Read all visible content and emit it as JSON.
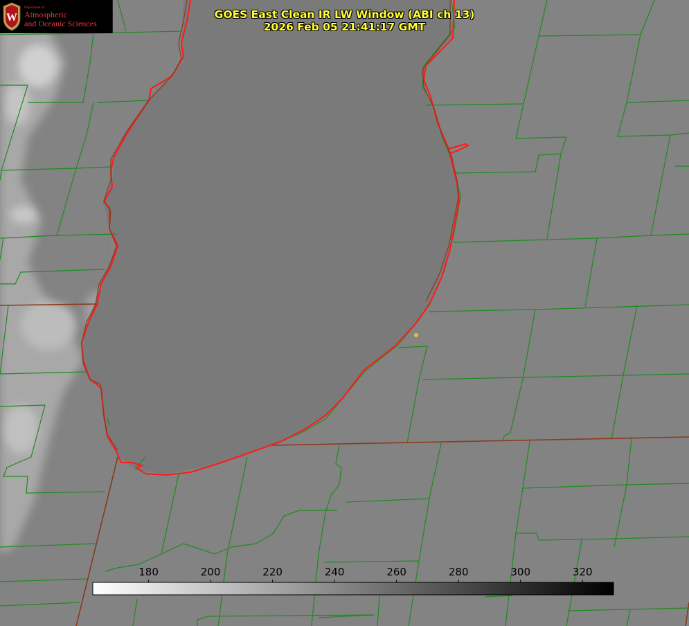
{
  "header": {
    "title_line1": "GOES East Clean IR LW Window (ABI ch 13)",
    "title_line2": "2026 Feb 05 21:41:17 GMT",
    "title_color": "#ffff33"
  },
  "logo": {
    "dept_text": "Department of",
    "line1": "Atmospheric",
    "line2": "and Oceanic Sciences",
    "seal_letter": "W",
    "text_color": "#e23b3b"
  },
  "colorbar": {
    "ticks": [
      180,
      200,
      220,
      240,
      260,
      280,
      300,
      320
    ],
    "min": 162,
    "max": 330,
    "gradient_from": "#ffffff",
    "gradient_to": "#000000"
  },
  "map_colors": {
    "county_lines": "#1f8a1f",
    "state_lines": "#8b3a1a",
    "lake_shoreline": "#ff1a1a",
    "station_dot": "#d8c82a",
    "background_gray": "#808080"
  }
}
